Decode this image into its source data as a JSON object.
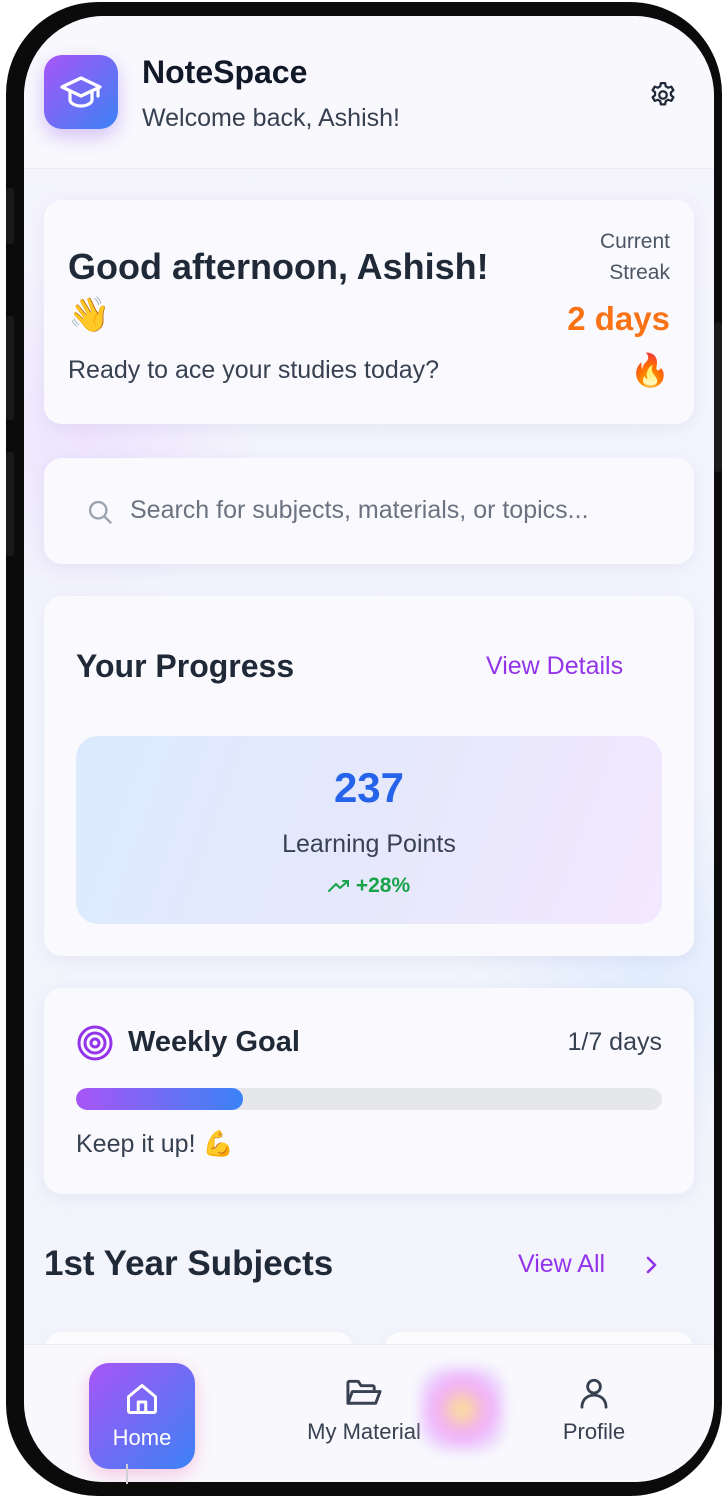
{
  "header": {
    "app_name": "NoteSpace",
    "welcome": "Welcome back, Ashish!",
    "icons": {
      "logo": "graduation-cap-icon",
      "settings": "gear-icon"
    }
  },
  "greeting": {
    "title": "Good afternoon, Ashish!",
    "emoji": "👋",
    "subtitle": "Ready to ace your studies today?",
    "streak_label": "Current Streak",
    "streak_value": "2 days",
    "streak_emoji": "🔥"
  },
  "search": {
    "placeholder": "Search for subjects, materials, or topics..."
  },
  "progress": {
    "title": "Your Progress",
    "link": "View Details",
    "points": "237",
    "points_label": "Learning Points",
    "trend": "+28%"
  },
  "weekly_goal": {
    "title": "Weekly Goal",
    "days": "1/7 days",
    "progress_fraction": 0.285,
    "note": "Keep it up! 💪"
  },
  "subjects": {
    "title": "1st Year Subjects",
    "link": "View All"
  },
  "nav": {
    "items": [
      {
        "label": "Home",
        "icon": "home-icon",
        "active": true
      },
      {
        "label": "My Material",
        "icon": "folder-icon",
        "active": false
      },
      {
        "label": "Profile",
        "icon": "user-icon",
        "active": false
      }
    ]
  },
  "colors": {
    "accent_purple": "#9333ea",
    "accent_blue": "#2563eb",
    "streak_orange": "#f97316",
    "trend_green": "#16a34a"
  }
}
